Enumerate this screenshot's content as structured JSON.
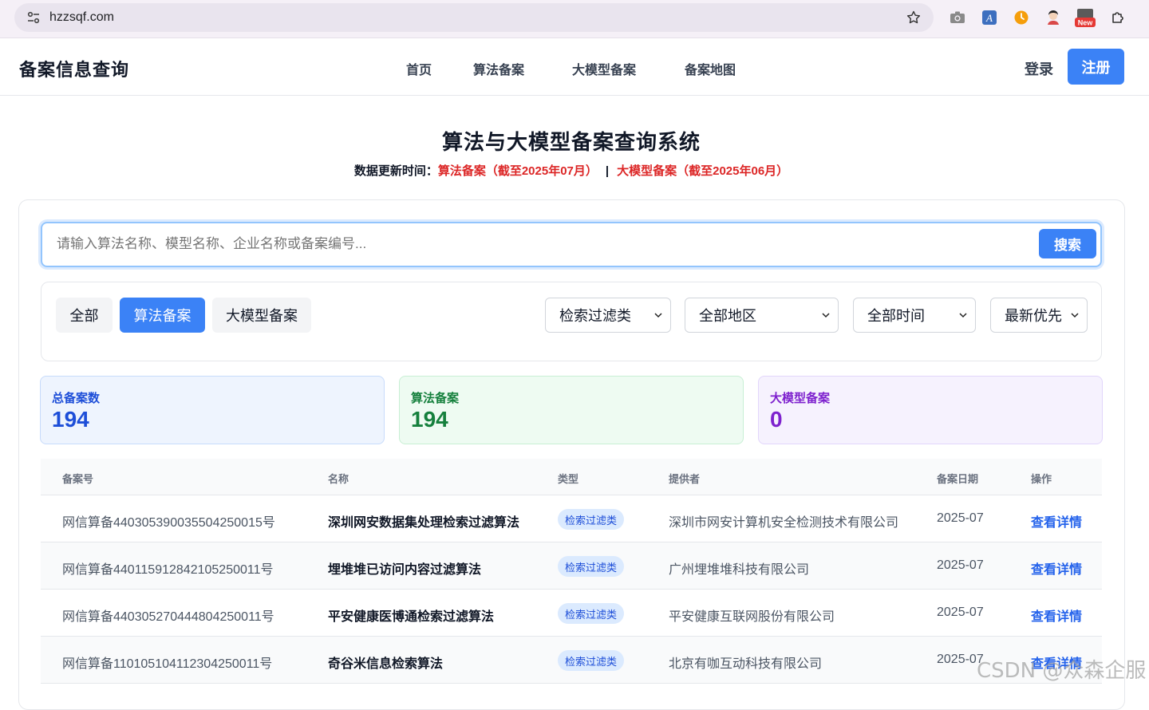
{
  "browser": {
    "url": "hzzsqf.com",
    "new_badge": "New",
    "ext_a_label": "A"
  },
  "header": {
    "logo": "备案信息查询",
    "nav": [
      "首页",
      "算法备案",
      "大模型备案",
      "备案地图"
    ],
    "login": "登录",
    "register": "注册"
  },
  "hero": {
    "title": "算法与大模型备案查询系统",
    "update_prefix": "数据更新时间：",
    "algo_update": "算法备案（截至2025年07月）",
    "separator": "|",
    "model_update": "大模型备案（截至2025年06月）"
  },
  "search": {
    "placeholder": "请输入算法名称、模型名称、企业名称或备案编号...",
    "button": "搜索"
  },
  "filters": {
    "tabs": [
      {
        "label": "全部",
        "active": false
      },
      {
        "label": "算法备案",
        "active": true
      },
      {
        "label": "大模型备案",
        "active": false
      }
    ],
    "selects": [
      "检索过滤类",
      "全部地区",
      "全部时间",
      "最新优先"
    ]
  },
  "stats": {
    "total": {
      "label": "总备案数",
      "value": "194"
    },
    "algo": {
      "label": "算法备案",
      "value": "194"
    },
    "model": {
      "label": "大模型备案",
      "value": "0"
    }
  },
  "table": {
    "headers": [
      "备案号",
      "名称",
      "类型",
      "提供者",
      "备案日期",
      "操作"
    ],
    "rows": [
      {
        "id": "网信算备440305390035504250015号",
        "name": "深圳网安数据集处理检索过滤算法",
        "type": "检索过滤类",
        "provider": "深圳市网安计算机安全检测技术有限公司",
        "date": "2025-07",
        "action": "查看详情"
      },
      {
        "id": "网信算备440115912842105250011号",
        "name": "埋堆堆已访问内容过滤算法",
        "type": "检索过滤类",
        "provider": "广州埋堆堆科技有限公司",
        "date": "2025-07",
        "action": "查看详情"
      },
      {
        "id": "网信算备440305270444804250011号",
        "name": "平安健康医博通检索过滤算法",
        "type": "检索过滤类",
        "provider": "平安健康互联网股份有限公司",
        "date": "2025-07",
        "action": "查看详情"
      },
      {
        "id": "网信算备110105104112304250011号",
        "name": "奇谷米信息检索算法",
        "type": "检索过滤类",
        "provider": "北京有咖互动科技有限公司",
        "date": "2025-07",
        "action": "查看详情"
      }
    ]
  },
  "watermark": "CSDN @众森企服",
  "colors": {
    "accent": "#3b82f6",
    "update_red": "#dc2626",
    "total_blue": "#1d4ed8",
    "algo_green": "#15803d",
    "model_purple": "#7e22ce"
  }
}
